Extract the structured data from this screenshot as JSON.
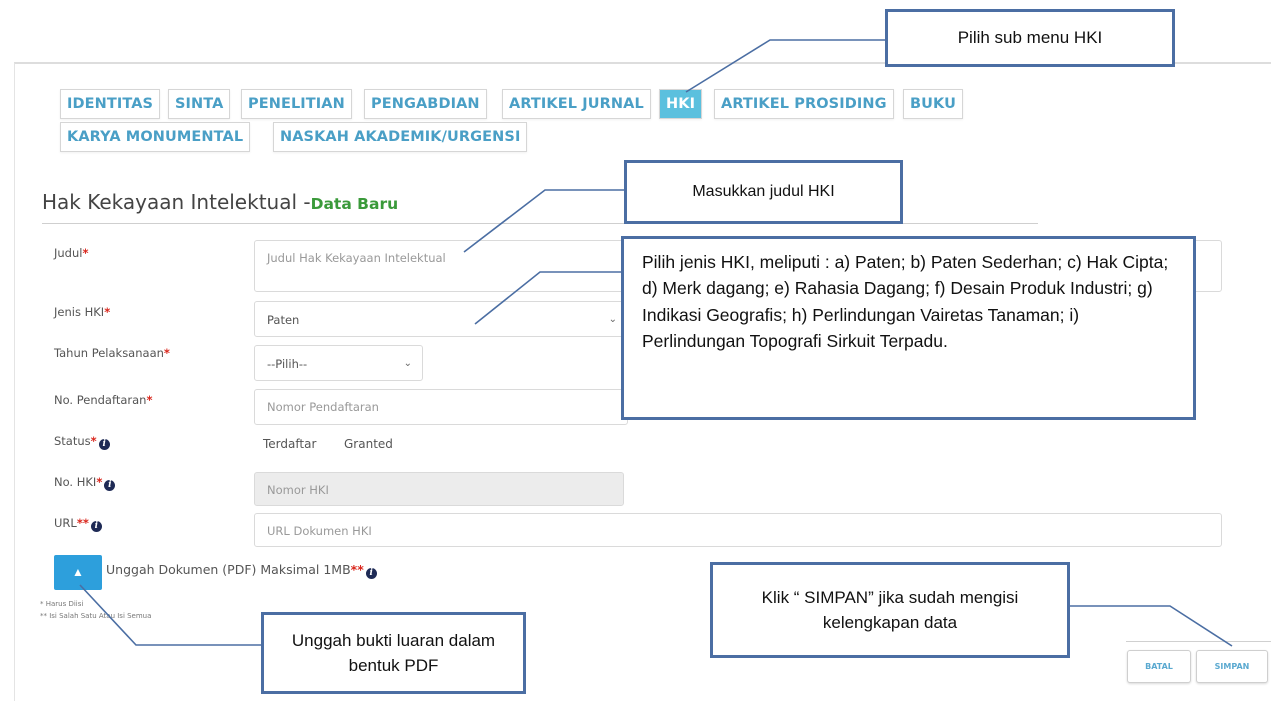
{
  "tabs": {
    "identitas": "IDENTITAS",
    "sinta": "SINTA",
    "penelitian": "PENELITIAN",
    "pengabdian": "PENGABDIAN",
    "artikel_jurnal": "ARTIKEL JURNAL",
    "hki": "HKI",
    "artikel_prosiding": "ARTIKEL PROSIDING",
    "buku": "BUKU",
    "karya_monumental": "KARYA MONUMENTAL",
    "naskah_akademik": "NASKAH AKADEMIK/URGENSI",
    "active": "HKI"
  },
  "page": {
    "title": "Hak Kekayaan Intelektual -",
    "subtitle": "Data Baru"
  },
  "form": {
    "judul_label": "Judul",
    "judul_placeholder": "Judul Hak Kekayaan Intelektual",
    "jenis_label": "Jenis HKI",
    "jenis_value": "Paten",
    "tahun_label": "Tahun Pelaksanaan",
    "tahun_value": "--Pilih--",
    "no_pendaftaran_label": "No. Pendaftaran",
    "no_pendaftaran_placeholder": "Nomor Pendaftaran",
    "status_label": "Status",
    "status_option_1": "Terdaftar",
    "status_option_2": "Granted",
    "no_hki_label": "No. HKI",
    "no_hki_placeholder": "Nomor HKI",
    "url_label": "URL",
    "url_placeholder": "URL Dokumen HKI",
    "upload_label": "Unggah Dokumen (PDF) Maksimal 1MB",
    "required_mark": "*",
    "either_mark": "**",
    "note_required": "* Harus Diisi",
    "note_either": "** Isi Salah Satu Atau Isi Semua"
  },
  "buttons": {
    "batal": "BATAL",
    "simpan": "SIMPAN"
  },
  "icons": {
    "upload": "upload-icon",
    "info": "info-icon",
    "dropdown": "chevron-down-icon"
  },
  "annotations": {
    "hki_menu": "Pilih sub menu HKI",
    "judul": "Masukkan judul HKI",
    "jenis": "Pilih jenis HKI, meliputi : a) Paten; b) Paten Sederhan; c) Hak Cipta; d) Merk dagang; e) Rahasia Dagang; f) Desain Produk Industri; g) Indikasi Geografis; h) Perlindungan Vairetas Tanaman; i) Perlindungan Topografi Sirkuit Terpadu.",
    "simpan": "Klik “ SIMPAN” jika sudah mengisi kelengkapan data",
    "upload": "Unggah bukti luaran dalam bentuk PDF"
  },
  "colors": {
    "tab_text": "#4a9fc6",
    "tab_active_bg": "#5bc0de",
    "subtitle": "#3a9a3a",
    "required": "#d9261c",
    "upload_button": "#2d9fdc",
    "callout_border": "#4b6ea3"
  }
}
